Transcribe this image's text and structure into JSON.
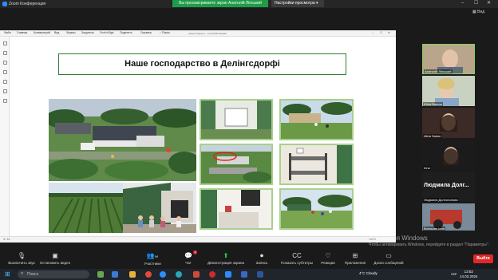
{
  "app": {
    "title": "Zoom Конференция"
  },
  "share_banner": "Вы просматриваете экран Анатолій Ліпський",
  "view_options": "Настройки просмотра",
  "view_button": "Вид",
  "ppt": {
    "menu": [
      "Файл",
      "Главная",
      "Конвертерий",
      "Вид",
      "Формы",
      "Защитить",
      "Foxit eSign",
      "Поделить",
      "Справка"
    ],
    "search": "Поиск",
    "doc_title": "шкаля Презент... Foxit PDF Reader",
    "slide_number": "4 / 11",
    "zoom": "100%"
  },
  "slide": {
    "title": "Наше господарство в Делінгсдорфі"
  },
  "watermark": {
    "line1": "Активация Windows",
    "line2": "Чтобы активировать Windows, перейдите в раздел \"Параметры\"."
  },
  "participants": [
    {
      "name": "Анатолій Ліпський",
      "kind": "video",
      "bg": "#b8a58c",
      "border": "#7fd55c"
    },
    {
      "name": "Юлія Барсук",
      "kind": "video",
      "bg": "#c9d2c0"
    },
    {
      "name": "Alina Saban",
      "kind": "video",
      "bg": "#3b2a26"
    },
    {
      "name": "Irina",
      "kind": "video",
      "bg": "#1b1b1b"
    },
    {
      "name": "Людмила Долгополова",
      "kind": "name",
      "display": "Людмила Долг...",
      "bg": "#1e1e1e"
    },
    {
      "name": "Волошин Іоля",
      "kind": "video",
      "bg": "#7a8a98"
    }
  ],
  "toolbar": {
    "mute": "Выключить звук",
    "video": "Остановить видео",
    "participants": "Участники",
    "participants_count": "99",
    "chat": "Чат",
    "chat_badge": "3",
    "share": "Демонстрация экрана",
    "record": "Запись",
    "captions": "Показать субтитры",
    "reactions": "Реакции",
    "apps": "Приложения",
    "whiteboards": "Доски сообщений",
    "end": "Выйти"
  },
  "taskbar": {
    "search": "Поиск",
    "weather": "4°C  Cloudy",
    "lang": "УКР",
    "time": "13:52",
    "date": "14.03.2024"
  }
}
